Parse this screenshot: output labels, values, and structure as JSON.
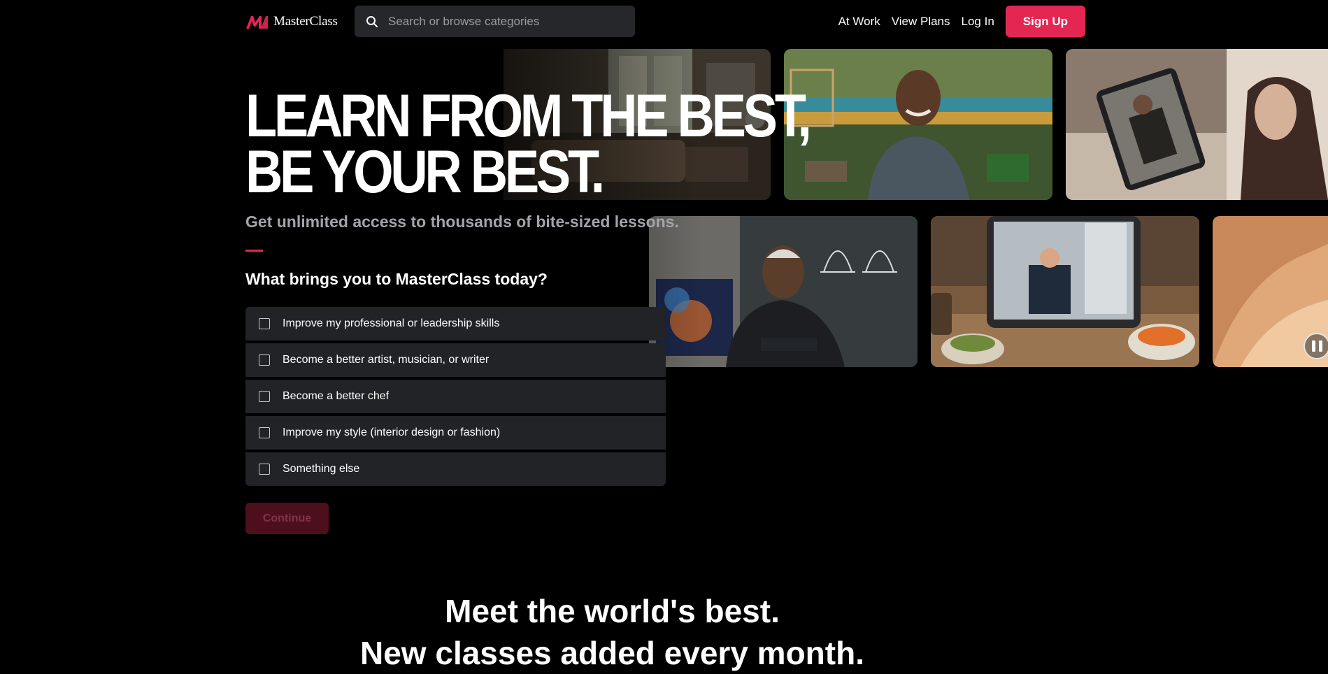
{
  "brand": {
    "name": "MasterClass",
    "accent_color": "#e32652"
  },
  "nav": {
    "search_placeholder": "Search or browse categories",
    "links": [
      "At Work",
      "View Plans",
      "Log In"
    ],
    "signup_label": "Sign Up"
  },
  "hero": {
    "headline_line1": "LEARN FROM THE BEST,",
    "headline_line2": "BE YOUR BEST.",
    "subheadline": "Get unlimited access to thousands of bite-sized lessons.",
    "question": "What brings you to MasterClass today?",
    "options": [
      "Improve my professional or leadership skills",
      "Become a better artist, musician, or writer",
      "Become a better chef",
      "Improve my style (interior design or fashion)",
      "Something else"
    ],
    "continue_label": "Continue"
  },
  "mosaic": {
    "pause_icon": "pause-icon"
  },
  "secondary": {
    "line1": "Meet the world's best.",
    "line2": "New classes added every month."
  }
}
